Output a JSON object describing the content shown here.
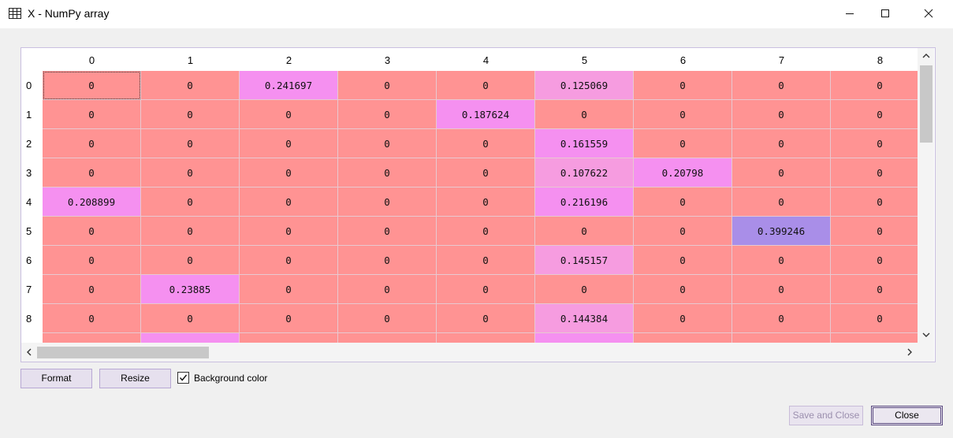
{
  "window": {
    "title": "X - NumPy array",
    "minimize_icon": "minimize-icon",
    "maximize_icon": "maximize-icon",
    "close_icon": "close-icon"
  },
  "table": {
    "column_headers": [
      "0",
      "1",
      "2",
      "3",
      "4",
      "5",
      "6",
      "7",
      "8"
    ],
    "row_headers": [
      "0",
      "1",
      "2",
      "3",
      "4",
      "5",
      "6",
      "7",
      "8"
    ],
    "rows": [
      [
        "0",
        "0",
        "0.241697",
        "0",
        "0",
        "0.125069",
        "0",
        "0",
        "0"
      ],
      [
        "0",
        "0",
        "0",
        "0",
        "0.187624",
        "0",
        "0",
        "0",
        "0"
      ],
      [
        "0",
        "0",
        "0",
        "0",
        "0",
        "0.161559",
        "0",
        "0",
        "0"
      ],
      [
        "0",
        "0",
        "0",
        "0",
        "0",
        "0.107622",
        "0.20798",
        "0",
        "0"
      ],
      [
        "0.208899",
        "0",
        "0",
        "0",
        "0",
        "0.216196",
        "0",
        "0",
        "0"
      ],
      [
        "0",
        "0",
        "0",
        "0",
        "0",
        "0",
        "0",
        "0.399246",
        "0"
      ],
      [
        "0",
        "0",
        "0",
        "0",
        "0",
        "0.145157",
        "0",
        "0",
        "0"
      ],
      [
        "0",
        "0.23885",
        "0",
        "0",
        "0",
        "0",
        "0",
        "0",
        "0"
      ],
      [
        "0",
        "0",
        "0",
        "0",
        "0",
        "0.144384",
        "0",
        "0",
        "0"
      ]
    ],
    "partial_row_colors": [
      "#ff9393",
      "#f590f0",
      "#ff9393",
      "#ff9393",
      "#ff9393",
      "#f590f0",
      "#ff9393",
      "#ff9393",
      "#ff9393"
    ],
    "selected_cell": "0,0"
  },
  "colors": {
    "zero": "#ff9393",
    "value_low": "#f590f0",
    "value_mid": "#f69ce0",
    "value_high": "#a98ee8",
    "selected_cell": "#ff9393"
  },
  "buttons": {
    "format": "Format",
    "resize": "Resize",
    "save_and_close": "Save and Close",
    "close": "Close"
  },
  "options": {
    "background_color_label": "Background color",
    "background_color_checked": true
  }
}
